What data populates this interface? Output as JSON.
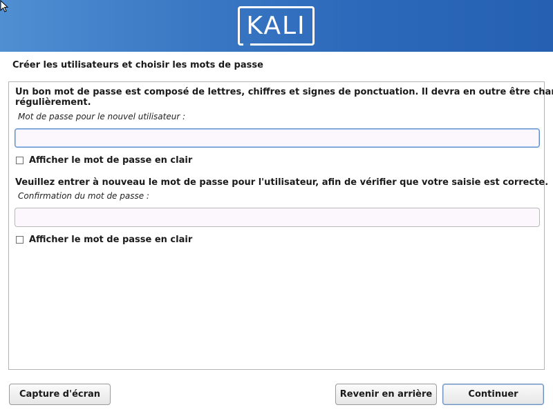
{
  "header": {
    "logo_text": "KALI",
    "background_color": "#3a78c4"
  },
  "page": {
    "title": "Créer les utilisateurs et choisir les mots de passe"
  },
  "form": {
    "intro_line1": "Un bon mot de passe est composé de lettres, chiffres et signes de ponctuation. Il devra en outre être changé",
    "intro_line2": "régulièrement.",
    "password_label": "Mot de passe pour le nouvel utilisateur :",
    "password_value": "",
    "show_password_label_1": "Afficher le mot de passe en clair",
    "show_password_checked_1": false,
    "confirm_intro": "Veuillez entrer à nouveau le mot de passe pour l'utilisateur, afin de vérifier que votre saisie est correcte.",
    "confirm_label": "Confirmation du mot de passe :",
    "confirm_value": "",
    "show_password_label_2": "Afficher le mot de passe en clair",
    "show_password_checked_2": false
  },
  "buttons": {
    "screenshot": "Capture d'écran",
    "back": "Revenir en arrière",
    "continue": "Continuer"
  }
}
